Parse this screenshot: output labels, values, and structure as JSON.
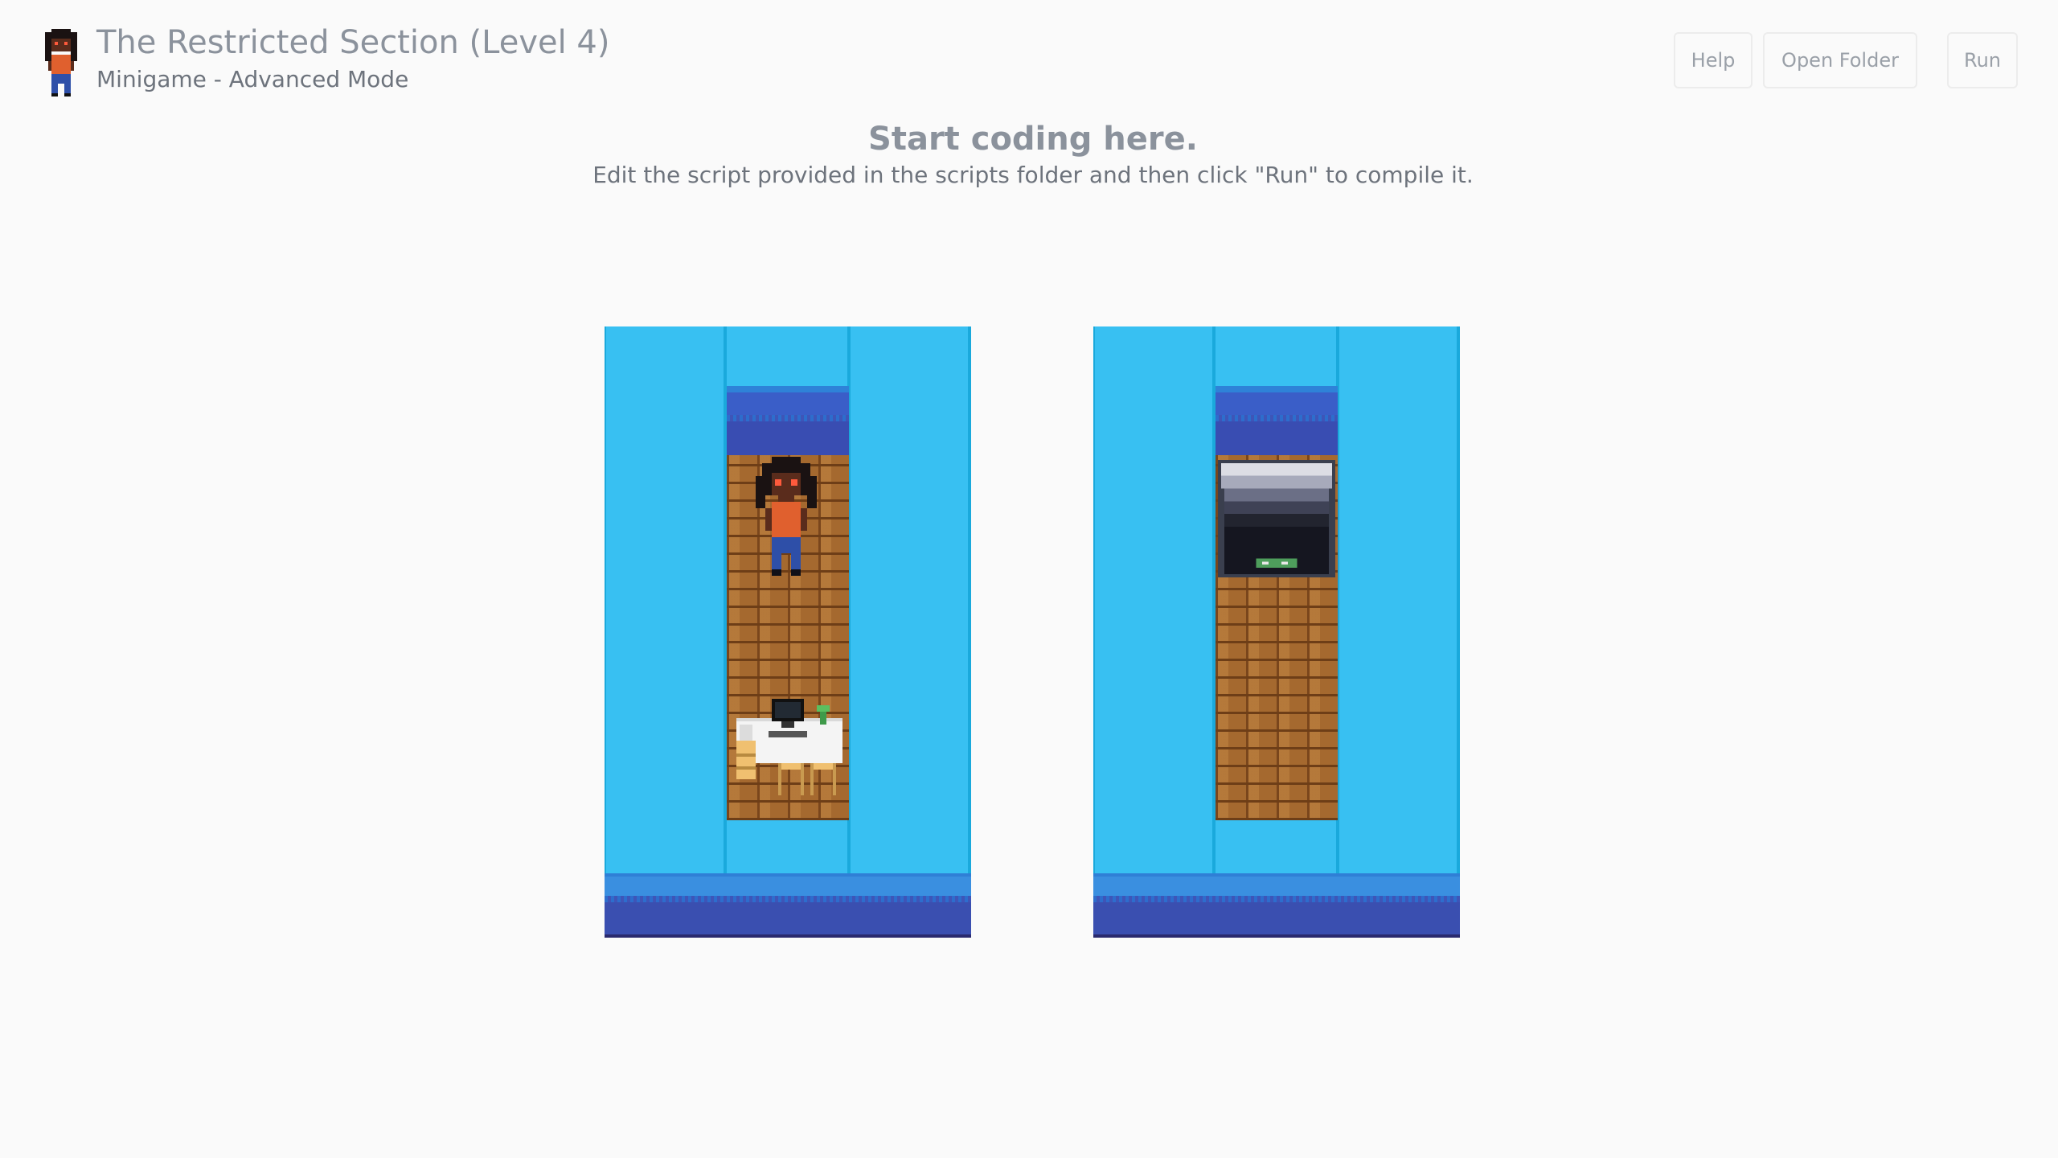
{
  "header": {
    "title": "The Restricted Section (Level 4)",
    "subtitle": "Minigame - Advanced Mode"
  },
  "toolbar": {
    "help_label": "Help",
    "open_folder_label": "Open Folder",
    "run_label": "Run"
  },
  "main": {
    "heading": "Start coding here.",
    "instructions": "Edit the script provided in the scripts folder and then click \"Run\" to compile it."
  },
  "boards": [
    {
      "name": "player-room",
      "contains": [
        "player-character",
        "computer-desk"
      ]
    },
    {
      "name": "target-room",
      "contains": [
        "open-floor-hatch"
      ]
    }
  ],
  "colors": {
    "background": "#fafafa",
    "water": "#38c0f2",
    "wall": "#394db2",
    "brick": "#a5692f"
  }
}
